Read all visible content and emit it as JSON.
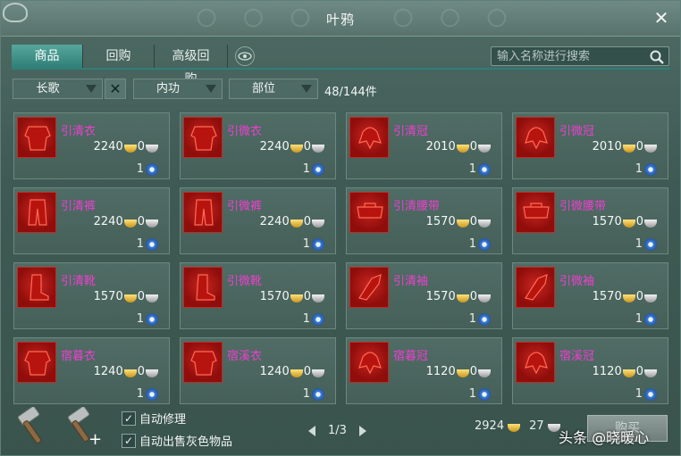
{
  "window": {
    "title": "叶鸦"
  },
  "tabs": [
    {
      "label": "商品",
      "active": true
    },
    {
      "label": "回购",
      "active": false
    },
    {
      "label": "高级回购",
      "active": false
    }
  ],
  "search": {
    "placeholder": "输入名称进行搜索",
    "value": ""
  },
  "filters": {
    "school": "长歌",
    "attribute": "内功",
    "slot": "部位",
    "count": "48/144件"
  },
  "items": [
    {
      "name": "引清衣",
      "price": "2240",
      "silver": "0",
      "qty": "1"
    },
    {
      "name": "引微衣",
      "price": "2240",
      "silver": "0",
      "qty": "1"
    },
    {
      "name": "引清冠",
      "price": "2010",
      "silver": "0",
      "qty": "1"
    },
    {
      "name": "引微冠",
      "price": "2010",
      "silver": "0",
      "qty": "1"
    },
    {
      "name": "引清裤",
      "price": "2240",
      "silver": "0",
      "qty": "1"
    },
    {
      "name": "引微裤",
      "price": "2240",
      "silver": "0",
      "qty": "1"
    },
    {
      "name": "引清腰带",
      "price": "1570",
      "silver": "0",
      "qty": "1"
    },
    {
      "name": "引微腰带",
      "price": "1570",
      "silver": "0",
      "qty": "1"
    },
    {
      "name": "引清靴",
      "price": "1570",
      "silver": "0",
      "qty": "1"
    },
    {
      "name": "引微靴",
      "price": "1570",
      "silver": "0",
      "qty": "1"
    },
    {
      "name": "引清袖",
      "price": "1570",
      "silver": "0",
      "qty": "1"
    },
    {
      "name": "引微袖",
      "price": "1570",
      "silver": "0",
      "qty": "1"
    },
    {
      "name": "宿暮衣",
      "price": "1240",
      "silver": "0",
      "qty": "1"
    },
    {
      "name": "宿溪衣",
      "price": "1240",
      "silver": "0",
      "qty": "1"
    },
    {
      "name": "宿暮冠",
      "price": "1120",
      "silver": "0",
      "qty": "1"
    },
    {
      "name": "宿溪冠",
      "price": "1120",
      "silver": "0",
      "qty": "1"
    }
  ],
  "options": {
    "auto_repair": "自动修理",
    "auto_sell_grey": "自动出售灰色物品"
  },
  "pager": {
    "text": "1/3"
  },
  "money": {
    "gold": "2924",
    "silver": "27"
  },
  "buy_button": "购买",
  "watermark": "头条 @晓暖心",
  "colors": {
    "item_name": "#ef3fd1",
    "tab_active": "#2f7f78",
    "panel": "#3f5a54"
  }
}
